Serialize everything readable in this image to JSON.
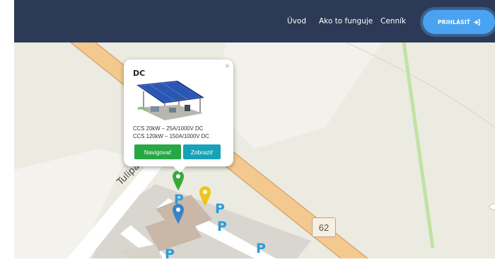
{
  "nav": {
    "links": [
      "Úvod",
      "Ako to funguje",
      "Cenník"
    ],
    "login_label": "PRIHLÁSIŤ",
    "login_icon": "sign-in-icon"
  },
  "colors": {
    "navbar": "#2c3a57",
    "login_button": "#4aa3f0",
    "navigate_button": "#28a745",
    "show_button": "#17a2b8",
    "map_background": "#ecebe2",
    "road": "#f4c98f",
    "marker_green": "#3aa93a",
    "marker_yellow": "#f0c419",
    "marker_blue": "#3b83c6"
  },
  "popup": {
    "close_symbol": "×",
    "title": "DC",
    "lines": [
      "CCS 20kW – 25A/1000V DC",
      "CCS 120kW – 150A/1000V DC"
    ],
    "navigate_label": "Navigovať",
    "show_label": "Zobraziť"
  },
  "map": {
    "street_name": "Tulipánová",
    "road_number": "62",
    "parking_label": "P"
  }
}
